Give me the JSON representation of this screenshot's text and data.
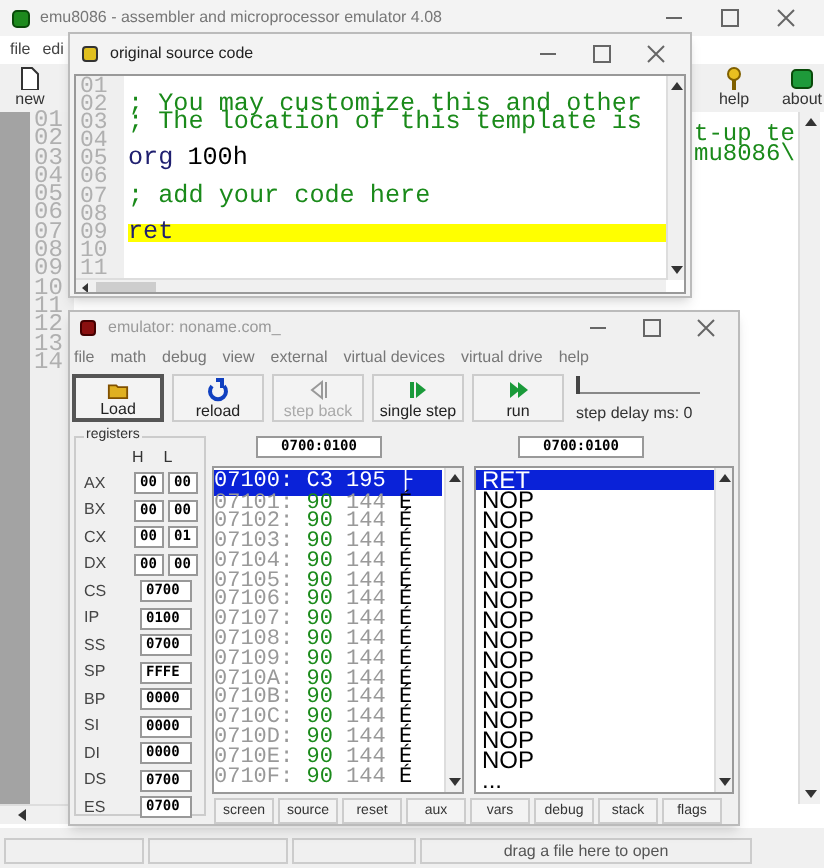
{
  "main_window": {
    "title": "emu8086 - assembler and microprocessor emulator 4.08",
    "menu": [
      "file",
      "edi"
    ],
    "toolbar": [
      {
        "label": "new",
        "kind": "new"
      },
      {
        "label": "help",
        "kind": "help"
      },
      {
        "label": "about",
        "kind": "about"
      }
    ],
    "editor": {
      "line_numbers": [
        "01",
        "02",
        "03",
        "04",
        "05",
        "06",
        "07",
        "08",
        "09",
        "10",
        "11",
        "12",
        "13",
        "14"
      ],
      "visible_text": [
        "t-up te",
        "mu8086\\"
      ]
    },
    "status_bar": "drag a file here to open"
  },
  "source_window": {
    "title": "original source code",
    "lines": [
      {
        "number": "01",
        "highlighted": false
      },
      {
        "number": "02",
        "highlighted": false,
        "tokens": [
          {
            "text": "; You may customize this and other",
            "kind": "comment"
          }
        ]
      },
      {
        "number": "03",
        "highlighted": false,
        "tokens": [
          {
            "text": "; The location of this template is",
            "kind": "comment"
          }
        ]
      },
      {
        "number": "04",
        "highlighted": false
      },
      {
        "number": "05",
        "highlighted": false,
        "tokens": [
          {
            "text": "org",
            "kind": "keyword"
          },
          {
            "text": "100h",
            "kind": "number"
          }
        ]
      },
      {
        "number": "06",
        "highlighted": false
      },
      {
        "number": "07",
        "highlighted": false,
        "tokens": [
          {
            "text": "; add your code here",
            "kind": "comment"
          }
        ]
      },
      {
        "number": "08",
        "highlighted": false
      },
      {
        "number": "09",
        "highlighted": true,
        "tokens": [
          {
            "text": "ret",
            "kind": "keyword"
          }
        ]
      },
      {
        "number": "10",
        "highlighted": false
      },
      {
        "number": "11",
        "highlighted": false
      }
    ]
  },
  "emulator": {
    "title": "emulator: noname.com_",
    "menu": [
      "file",
      "math",
      "debug",
      "view",
      "external",
      "virtual devices",
      "virtual drive",
      "help"
    ],
    "toolbar": [
      {
        "label": "Load",
        "kind": "load",
        "disabled": false,
        "default": true
      },
      {
        "label": "reload",
        "kind": "reload",
        "disabled": false,
        "default": false
      },
      {
        "label": "step back",
        "kind": "step_back",
        "disabled": true,
        "default": false
      },
      {
        "label": "single step",
        "kind": "single_step",
        "disabled": false,
        "default": false
      },
      {
        "label": "run",
        "kind": "run",
        "disabled": false,
        "default": false
      }
    ],
    "step_delay": {
      "label": "step delay ms: 0",
      "level": 0
    },
    "registers": {
      "title": "registers",
      "high_header": "H",
      "low_header": "L",
      "rows": [
        {
          "name": "AX",
          "kind": "split",
          "high": "00",
          "low": "00"
        },
        {
          "name": "BX",
          "kind": "split",
          "high": "00",
          "low": "00"
        },
        {
          "name": "CX",
          "kind": "split",
          "high": "00",
          "low": "01"
        },
        {
          "name": "DX",
          "kind": "split",
          "high": "00",
          "low": "00"
        },
        {
          "name": "CS",
          "kind": "word",
          "value": "0700"
        },
        {
          "name": "IP",
          "kind": "word",
          "value": "0100"
        },
        {
          "name": "SS",
          "kind": "word",
          "value": "0700"
        },
        {
          "name": "SP",
          "kind": "word",
          "value": "FFFE"
        },
        {
          "name": "BP",
          "kind": "word",
          "value": "0000"
        },
        {
          "name": "SI",
          "kind": "word",
          "value": "0000"
        },
        {
          "name": "DI",
          "kind": "word",
          "value": "0000"
        },
        {
          "name": "DS",
          "kind": "word",
          "value": "0700"
        },
        {
          "name": "ES",
          "kind": "word",
          "value": "0700"
        }
      ]
    },
    "memory_address": "0700:0100",
    "disassembly_address": "0700:0100",
    "memory": [
      {
        "address": "07100:",
        "hex": "C3",
        "dec": "195",
        "char": "├",
        "selected": true
      },
      {
        "address": "07101:",
        "hex": "90",
        "dec": "144",
        "char": "É",
        "selected": false
      },
      {
        "address": "07102:",
        "hex": "90",
        "dec": "144",
        "char": "É",
        "selected": false
      },
      {
        "address": "07103:",
        "hex": "90",
        "dec": "144",
        "char": "É",
        "selected": false
      },
      {
        "address": "07104:",
        "hex": "90",
        "dec": "144",
        "char": "É",
        "selected": false
      },
      {
        "address": "07105:",
        "hex": "90",
        "dec": "144",
        "char": "É",
        "selected": false
      },
      {
        "address": "07106:",
        "hex": "90",
        "dec": "144",
        "char": "É",
        "selected": false
      },
      {
        "address": "07107:",
        "hex": "90",
        "dec": "144",
        "char": "É",
        "selected": false
      },
      {
        "address": "07108:",
        "hex": "90",
        "dec": "144",
        "char": "É",
        "selected": false
      },
      {
        "address": "07109:",
        "hex": "90",
        "dec": "144",
        "char": "É",
        "selected": false
      },
      {
        "address": "0710A:",
        "hex": "90",
        "dec": "144",
        "char": "É",
        "selected": false
      },
      {
        "address": "0710B:",
        "hex": "90",
        "dec": "144",
        "char": "É",
        "selected": false
      },
      {
        "address": "0710C:",
        "hex": "90",
        "dec": "144",
        "char": "É",
        "selected": false
      },
      {
        "address": "0710D:",
        "hex": "90",
        "dec": "144",
        "char": "É",
        "selected": false
      },
      {
        "address": "0710E:",
        "hex": "90",
        "dec": "144",
        "char": "É",
        "selected": false
      },
      {
        "address": "0710F:",
        "hex": "90",
        "dec": "144",
        "char": "É",
        "selected": false
      }
    ],
    "disassembly": [
      {
        "text": "RET",
        "selected": true
      },
      {
        "text": "NOP",
        "selected": false
      },
      {
        "text": "NOP",
        "selected": false
      },
      {
        "text": "NOP",
        "selected": false
      },
      {
        "text": "NOP",
        "selected": false
      },
      {
        "text": "NOP",
        "selected": false
      },
      {
        "text": "NOP",
        "selected": false
      },
      {
        "text": "NOP",
        "selected": false
      },
      {
        "text": "NOP",
        "selected": false
      },
      {
        "text": "NOP",
        "selected": false
      },
      {
        "text": "NOP",
        "selected": false
      },
      {
        "text": "NOP",
        "selected": false
      },
      {
        "text": "NOP",
        "selected": false
      },
      {
        "text": "NOP",
        "selected": false
      },
      {
        "text": "NOP",
        "selected": false
      },
      {
        "text": "...",
        "selected": false
      }
    ],
    "bottom_buttons": [
      "screen",
      "source",
      "reset",
      "aux",
      "vars",
      "debug",
      "stack",
      "flags"
    ]
  }
}
